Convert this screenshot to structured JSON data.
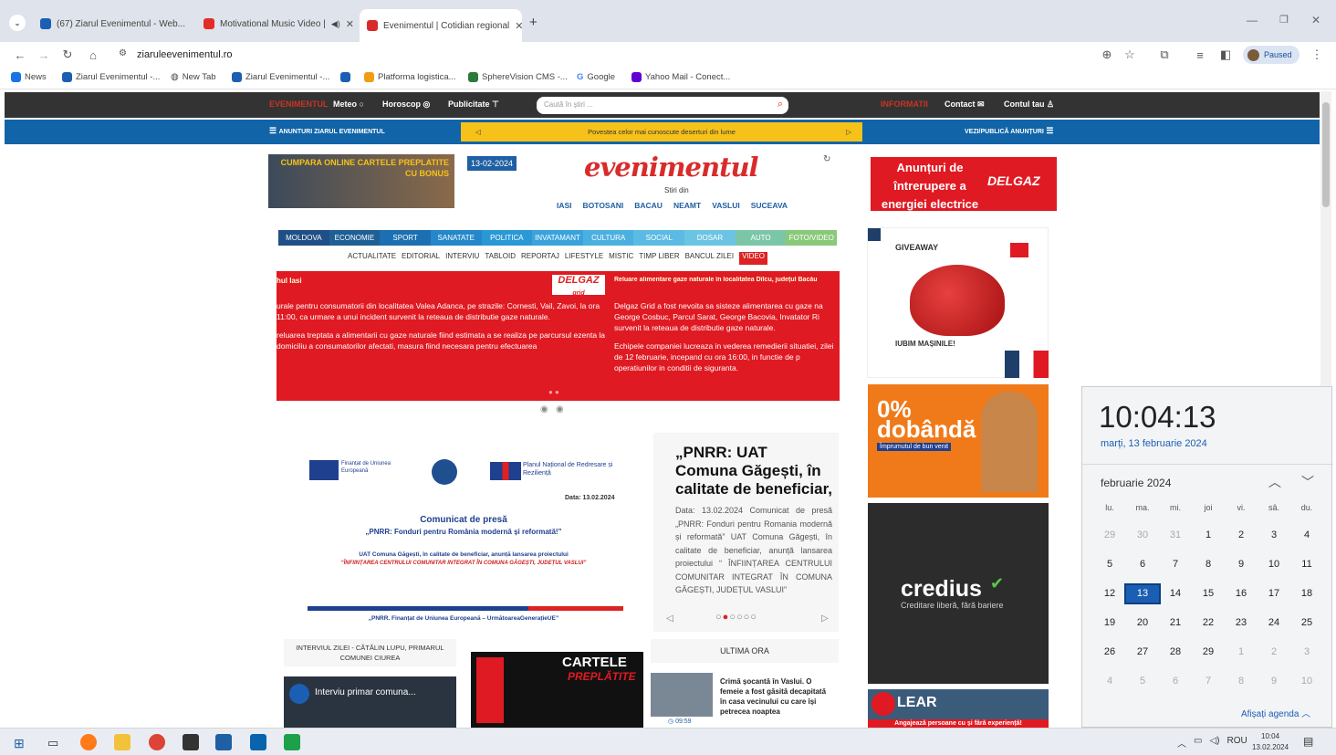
{
  "browser": {
    "tabs": [
      {
        "label": "(67) Ziarul Evenimentul - Web..."
      },
      {
        "label": "Motivational Music Video |"
      },
      {
        "label": "Evenimentul | Cotidian regional"
      }
    ],
    "url": "ziaruleevenimentul.ro",
    "profile": "Paused",
    "bookmarks": [
      "News",
      "Ziarul Evenimentul -...",
      "New Tab",
      "Ziarul Evenimentul -...",
      "Platforma logistica...",
      "SphereVision CMS -...",
      "Google",
      "Yahoo Mail - Conect..."
    ]
  },
  "site": {
    "topbar": {
      "meteo": "Meteo",
      "horoscop": "Horoscop",
      "publicitate": "Publicitate",
      "search_placeholder": "Caută în știri ...",
      "contact": "Contact",
      "account": "Contul tau"
    },
    "bluebar": {
      "left": "ANUNTURI ZIARUL EVENIMENTUL",
      "ticker": "Povestea celor mai cunoscute deserturi din lume",
      "right": "VEZI/PUBLICĂ ANUNȚURI"
    },
    "promo_banner": "CUMPARA ONLINE CARTELE PREPLATITE CU BONUS",
    "date": "13-02-2024",
    "logo": "evenimentul",
    "logo_sub": "Stiri din",
    "cities": [
      "IASI",
      "BOTOSANI",
      "BACAU",
      "NEAMT",
      "VASLUI",
      "SUCEAVA"
    ],
    "nav": [
      "MOLDOVA",
      "ECONOMIE",
      "SPORT",
      "SANATATE",
      "POLITICA",
      "INVATAMANT",
      "CULTURA",
      "SOCIAL",
      "DOSAR",
      "AUTO",
      "FOTO/VIDEO"
    ],
    "subnav": [
      "ACTUALITATE",
      "EDITORIAL",
      "INTERVIU",
      "TABLOID",
      "REPORTAJ",
      "LIFESTYLE",
      "MISTIC",
      "TIMP LIBER",
      "BANCUL ZILEI",
      "VIDEO"
    ],
    "red_notice": {
      "left_title": "hul Iasi",
      "left_p1": "urale pentru consumatorii din localitatea Valea Adanca, pe strazile: Cornesti, Vail, Zavoi, la ora 11:00, ca urmare a unui incident survenit la reteaua de distributie gaze naturale.",
      "left_p2": "reluarea treptata a alimentarii cu gaze naturale fiind estimata a se realiza pe parcursul ezenta la domiciliu a consumatorilor afectati, masura fiind necesara pentru efectuarea",
      "brand": "DELGAZ",
      "brand_sub": "grid",
      "right_title": "Reluare alimentare gaze naturale în localitatea Dîlcu, județul Bacău",
      "right_p1": "Delgaz Grid a fost nevoita sa sisteze alimentarea cu gaze na George Cosbuc, Parcul Sarat, George Bacovia, Invatator Ri survenit la reteaua de distributie gaze naturale.",
      "right_p2": "Echipele companiei lucreaza in vederea remedierii situatiei, zilei de 12 februarie, incepand cu ora 16:00, in functie de p operatiunilor in conditii de siguranta."
    },
    "press": {
      "eu_label": "Finanțat de Uniunea Europeană",
      "pnrr_label": "Planul Național de Redresare și Reziliență",
      "date": "Data: 13.02.2024",
      "heading": "Comunicat de presă",
      "subheading": "„PNRR: Fonduri pentru România modernă și reformată!”",
      "body": "UAT Comuna Găgești, în calitate de beneficiar, anunță lansarea proiectului",
      "project": "“ÎNFIINȚAREA CENTRULUI COMUNITAR INTEGRAT ÎN COMUNA GĂGEȘTI, JUDEȚUL VASLUI”",
      "footer": "„PNRR. Finanțat de Uniunea Europeană – UrmătoareaGenerațieUE”"
    },
    "headline": {
      "title": "„PNRR: UAT Comuna Găgești, în calitate de beneficiar,",
      "excerpt": "Data: 13.02.2024 Comunicat de presă „PNRR: Fonduri pentru Romania modernă și reformată” UAT Comuna Găgești, în calitate de beneficiar, anunță lansarea proiectului “ ÎNFIINȚAREA CENTRULUI COMUNITAR INTEGRAT ÎN COMUNA GĂGEȘTI, JUDEȚUL VASLUI”"
    },
    "interview": {
      "label": "INTERVIUL ZILEI - CĂTĂLIN LUPU, PRIMARUL COMUNEI CIUREA",
      "video_title": "Interviu primar comuna..."
    },
    "cards_ad": {
      "title": "CARTELE",
      "title2": "PREPLĂTITE"
    },
    "latest": {
      "label": "ULTIMA ORA",
      "item": "Crimă șocantă în Vaslui. O femeie a fost găsită decapitată în casa vecinului cu care își petrecea noaptea",
      "time": "09:59"
    },
    "ads": {
      "outage": "Anunțuri de întrerupere a energiei electrice",
      "outage_brand": "DELGAZ",
      "giveaway": "GIVEAWAY",
      "giveaway_footer": "IUBIM MAȘINILE!",
      "dobanda": "0% dobândă",
      "dobanda_sub": "Împrumutul de bun venit",
      "credius": "credius",
      "credius_sub": "Creditare liberă, fără bariere",
      "lear": "LEAR",
      "lear_sub": "Angajează persoane cu și fără experiență!"
    }
  },
  "calendar": {
    "time": "10:04:13",
    "date_long": "marți, 13 februarie 2024",
    "month": "februarie 2024",
    "weekdays": [
      "lu.",
      "ma.",
      "mi.",
      "joi",
      "vi.",
      "sâ.",
      "du."
    ],
    "days": [
      "29",
      "30",
      "31",
      "1",
      "2",
      "3",
      "4",
      "5",
      "6",
      "7",
      "8",
      "9",
      "10",
      "11",
      "12",
      "13",
      "14",
      "15",
      "16",
      "17",
      "18",
      "19",
      "20",
      "21",
      "22",
      "23",
      "24",
      "25",
      "26",
      "27",
      "28",
      "29",
      "1",
      "2",
      "3",
      "4",
      "5",
      "6",
      "7",
      "8",
      "9",
      "10"
    ],
    "agenda": "Afișați agenda"
  },
  "taskbar": {
    "lang": "ROU",
    "time": "10:04",
    "date": "13.02.2024"
  },
  "colors": {
    "red": "#e01a22",
    "blue": "#1164a8",
    "dark": "#333333",
    "yellow": "#f6c21a",
    "highlight": "#1a5fb4"
  }
}
